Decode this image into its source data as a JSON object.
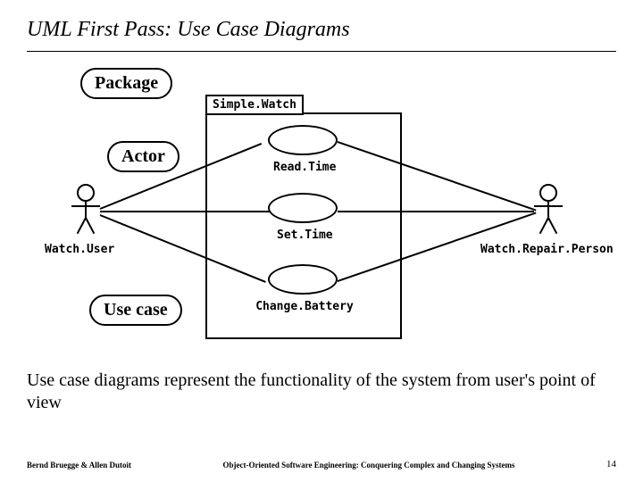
{
  "title": "UML First Pass: Use Case Diagrams",
  "callouts": {
    "package": "Package",
    "actor": "Actor",
    "usecase": "Use case"
  },
  "package_name": "Simple.Watch",
  "usecases": {
    "read_time": "Read.Time",
    "set_time": "Set.Time",
    "change_battery": "Change.Battery"
  },
  "actors": {
    "watch_user": "Watch.User",
    "watch_repair": "Watch.Repair.Person"
  },
  "body_text": "Use case diagrams represent the functionality of the system from user's point of view",
  "footer": {
    "left": "Bernd Bruegge & Allen Dutoit",
    "center": "Object-Oriented Software Engineering: Conquering Complex and Changing Systems",
    "right": "14"
  }
}
